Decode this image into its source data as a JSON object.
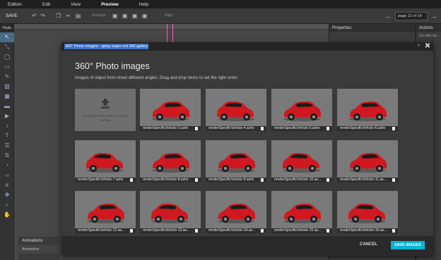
{
  "menu": {
    "items": [
      "Edition",
      "Edit",
      "View",
      "Preview",
      "Help"
    ],
    "active": "Preview"
  },
  "toolbar": {
    "save_label": "SAVE",
    "arrange_label": "Arrange",
    "align_label": "Align",
    "page_value": "page 12 of 14"
  },
  "tools": {
    "title": "Tools"
  },
  "properties": {
    "title": "Properties"
  },
  "actions": {
    "title": "Actions",
    "text": "On click do..."
  },
  "animations": {
    "title": "Animations",
    "sub": "Animation"
  },
  "modal": {
    "title": "360° Photo images - xplay super red 360 gallery",
    "heading": "360° Photo images",
    "description": "Images of object from shoot different angles. Drag and drop items to set the right order.",
    "upload_text": "Drag your files here or click to upload",
    "images": [
      "renderSpecificVehicle-3.ashx",
      "renderSpecificVehicle-4.ashx",
      "renderSpecificVehicle-5.ashx",
      "renderSpecificVehicle-6.ashx",
      "renderSpecificVehicle-7.ashx",
      "renderSpecificVehicle-8.ashx",
      "renderSpecificVehicle-9.ashx",
      "renderSpecificVehicle-10.as...",
      "renderSpecificVehicle-11.as...",
      "renderSpecificVehicle-12.as...",
      "renderSpecificVehicle-13.as...",
      "renderSpecificVehicle-14.as...",
      "renderSpecificVehicle-15.as...",
      "renderSpecificVehicle-16.as..."
    ],
    "cancel_label": "CANCEL",
    "save_label": "SAVE IMAGES",
    "accent_color": "#0ab3d3",
    "car_color": "#d01820"
  }
}
